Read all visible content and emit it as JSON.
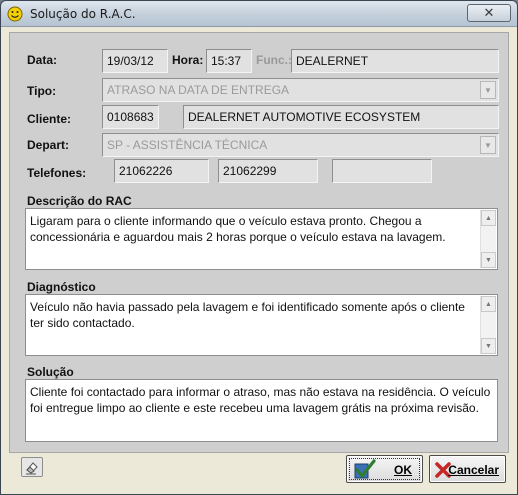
{
  "window": {
    "title": "Solução do R.A.C.",
    "close_symbol": "✕"
  },
  "header": {
    "data_label": "Data:",
    "data_value": "19/03/12",
    "hora_label": "Hora:",
    "hora_value": "15:37",
    "func_label": "Func.:",
    "func_value": "DEALERNET",
    "tipo_label": "Tipo:",
    "tipo_value": "ATRASO NA DATA DE ENTREGA",
    "cliente_label": "Cliente:",
    "cliente_code": "0108683",
    "cliente_name": "DEALERNET AUTOMOTIVE ECOSYSTEM",
    "depart_label": "Depart:",
    "depart_value": "SP - ASSISTÊNCIA TÉCNICA",
    "telefones_label": "Telefones:",
    "telefone1": "21062226",
    "telefone2": "21062299",
    "telefone3": ""
  },
  "sections": {
    "descricao_label": "Descrição do RAC",
    "descricao_text": "Ligaram para o cliente informando que o veículo estava pronto. Chegou a concessionária e aguardou mais 2 horas porque o veículo estava na lavagem.",
    "diagnostico_label": "Diagnóstico",
    "diagnostico_text": "Veículo não havia passado pela lavagem e foi identificado somente após o cliente ter sido contactado.",
    "solucao_label": "Solução",
    "solucao_text": "Cliente foi contactado para informar o atraso, mas não estava na residência. O veículo foi entregue limpo ao cliente e este recebeu uma lavagem grátis na próxima revisão."
  },
  "buttons": {
    "ok_label": "OK",
    "cancel_label": "Cancelar"
  },
  "icons": {
    "app": "smiley-icon",
    "combo": "dropdown-arrow-icon",
    "ok": "check-icon",
    "cancel": "x-icon",
    "tool": "eraser-icon"
  },
  "colors": {
    "ok_check": "#2e7d32",
    "cancel_x": "#c62828",
    "smiley": "#f5d000"
  }
}
